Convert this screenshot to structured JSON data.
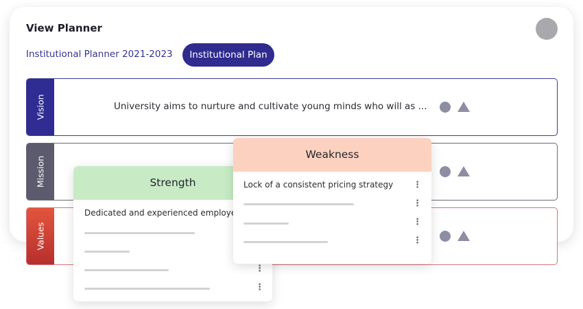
{
  "header": {
    "title": "View Planner",
    "breadcrumb": "Institutional Planner 2021-2023",
    "active_tab": "Institutional Plan"
  },
  "sections": [
    {
      "label": "Vision",
      "text": "University aims to nurture and cultivate young minds who will as ..."
    },
    {
      "label": "Mission",
      "text": ""
    },
    {
      "label": "Values",
      "text": ""
    }
  ],
  "strength_card": {
    "title": "Strength",
    "items": [
      "Dedicated and experienced employe"
    ]
  },
  "weakness_card": {
    "title": "Weakness",
    "items": [
      "Lock of a consistent pricing strategy"
    ]
  },
  "colors": {
    "accent": "#302b8f",
    "vision_tab": "#2f2c93",
    "mission_tab": "#5c5b6d",
    "values_tab": "#c83c33",
    "strength_header": "#c8ebc5",
    "weakness_header": "#fcd1c0"
  }
}
